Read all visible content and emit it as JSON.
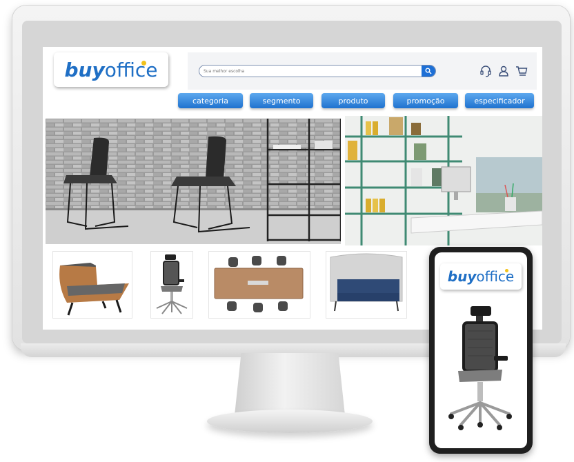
{
  "logo": {
    "part1": "buy",
    "part2": "office"
  },
  "search": {
    "placeholder": "Sua melhor escolha",
    "value": ""
  },
  "nav": [
    {
      "label": "categoria"
    },
    {
      "label": "segmento"
    },
    {
      "label": "produto"
    },
    {
      "label": "promoção"
    },
    {
      "label": "especificador"
    }
  ],
  "header_icons": [
    "headset-icon",
    "user-icon",
    "cart-icon"
  ],
  "products": [
    {
      "name": "lounge-armchair"
    },
    {
      "name": "office-chair"
    },
    {
      "name": "meeting-table"
    },
    {
      "name": "booth-sofa"
    }
  ],
  "phone": {
    "logo_part1": "buy",
    "logo_part2": "office"
  },
  "colors": {
    "brand_blue": "#1f6fc5",
    "accent_yellow": "#f2c21b",
    "nav_button": "#3d8de0"
  }
}
